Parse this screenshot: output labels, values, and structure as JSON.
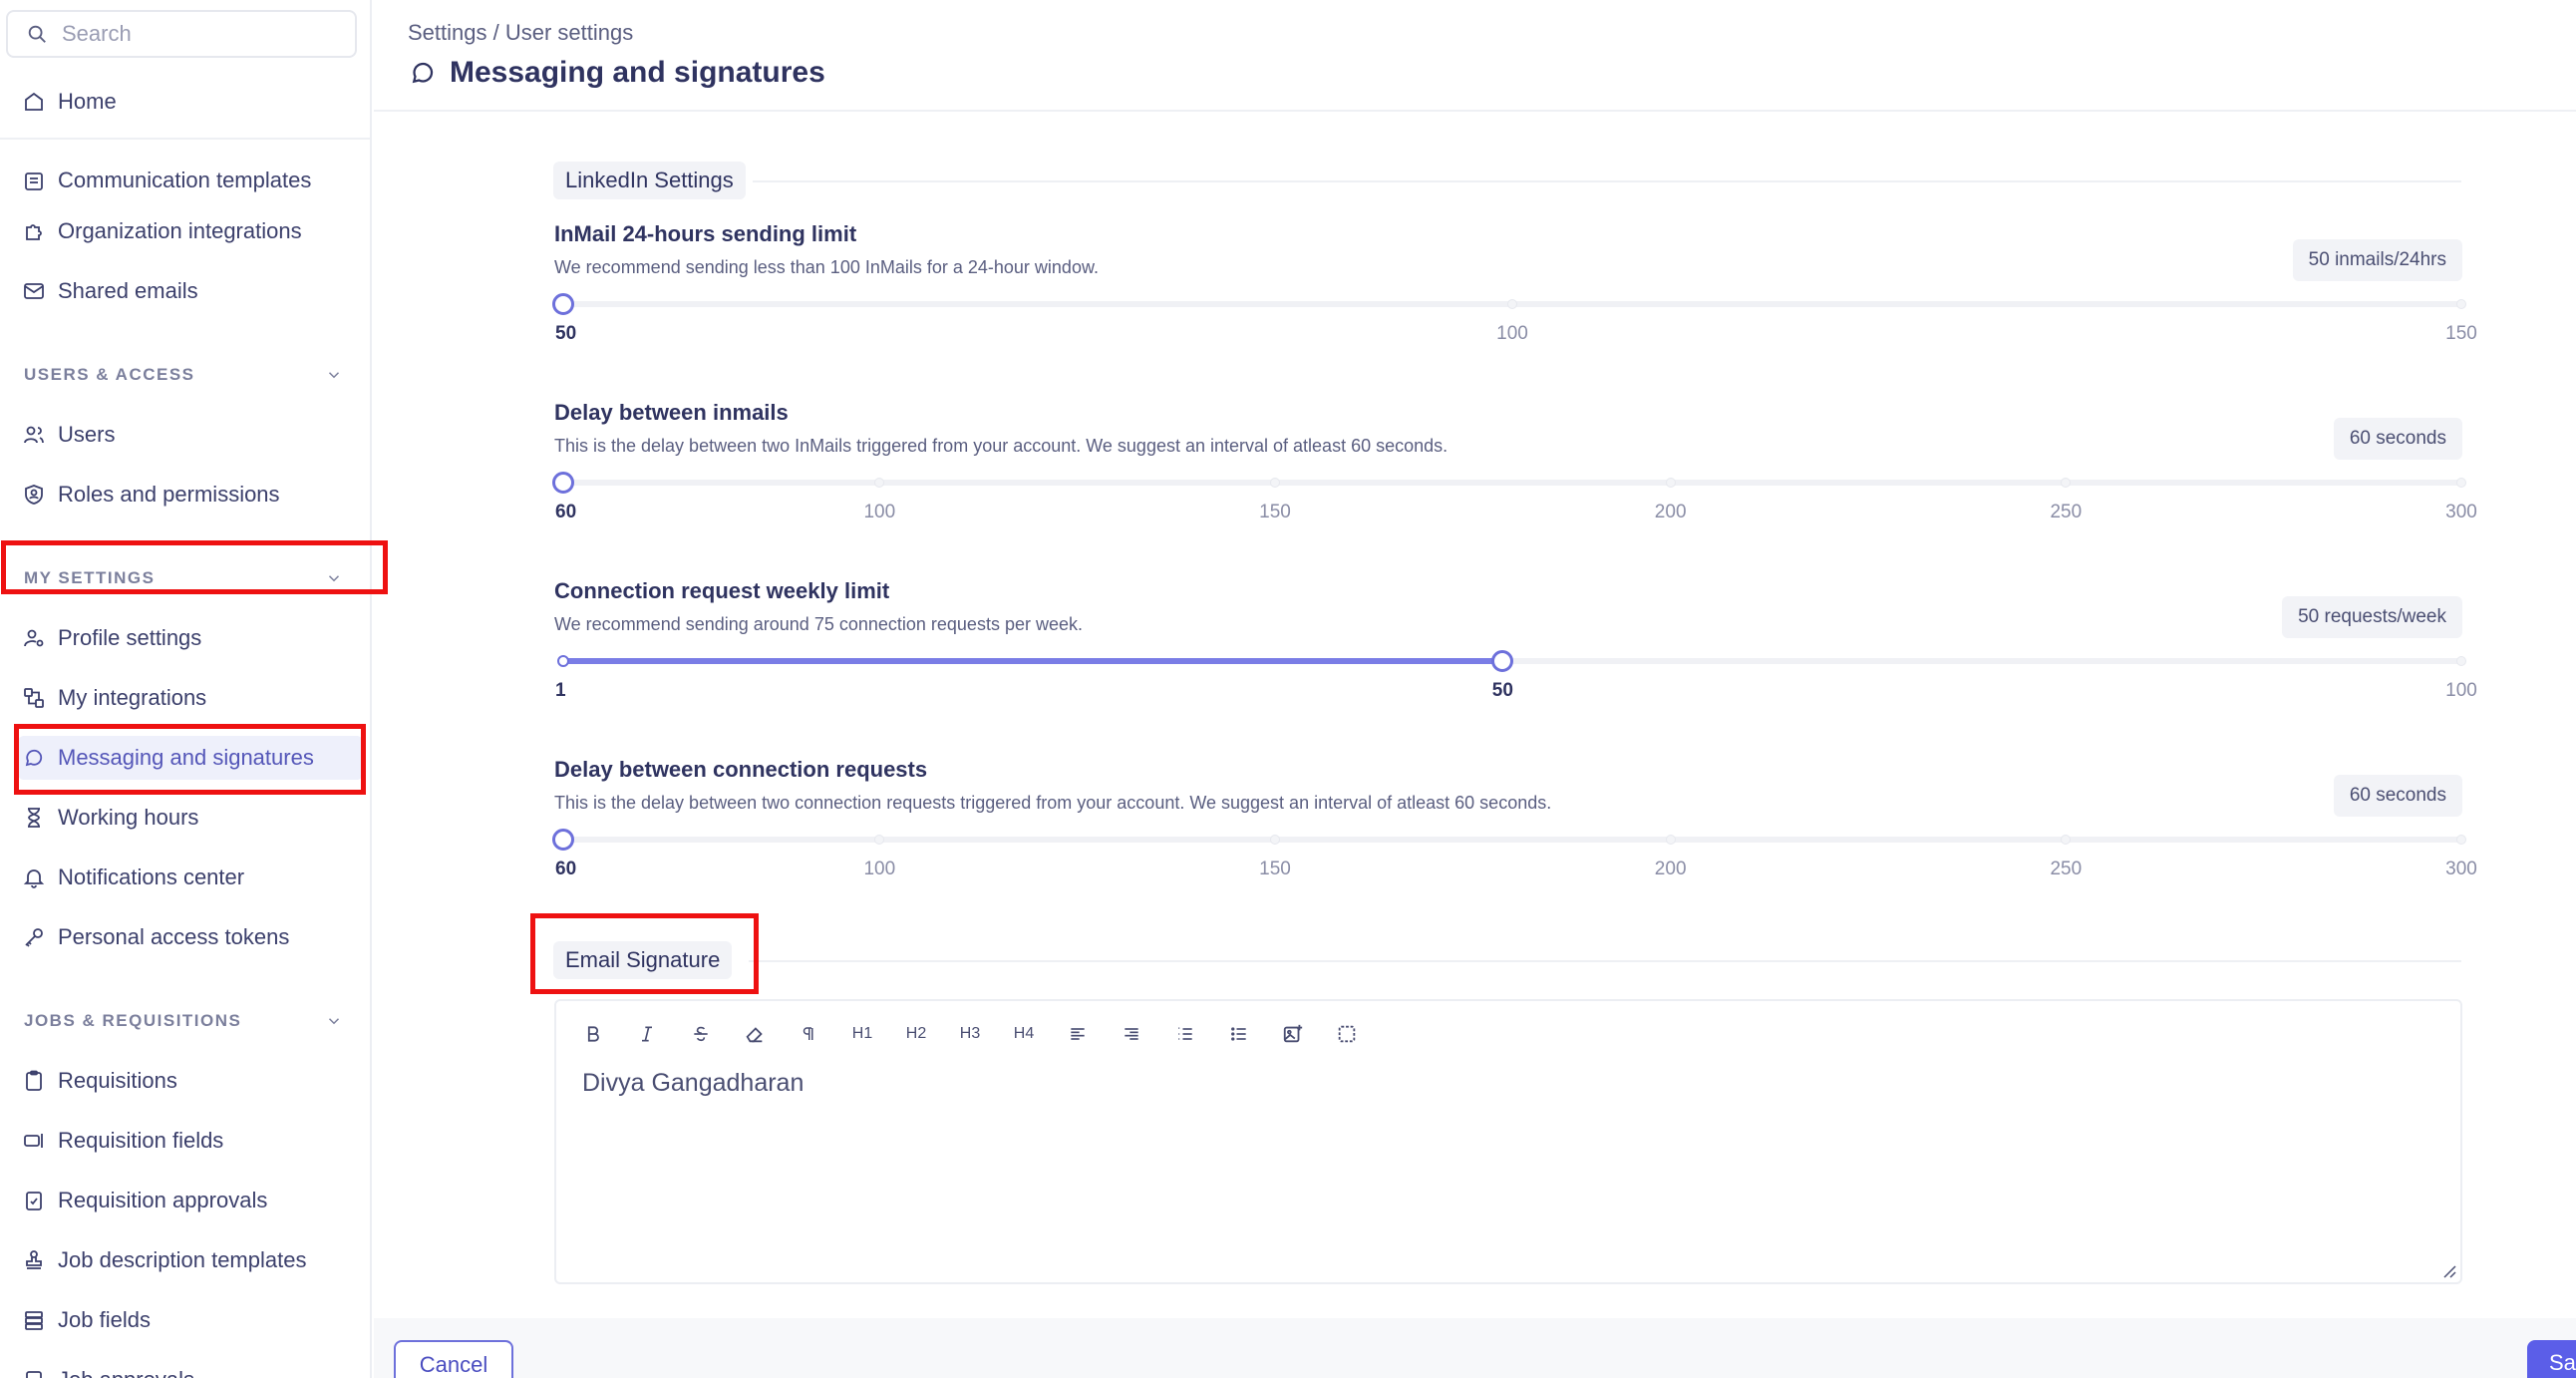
{
  "search": {
    "placeholder": "Search"
  },
  "sidebar": {
    "home": "Home",
    "org_items": [
      "Communication templates",
      "Organization integrations",
      "Shared emails"
    ],
    "users_access": {
      "title": "USERS & ACCESS",
      "items": [
        "Users",
        "Roles and permissions"
      ]
    },
    "my_settings": {
      "title": "MY SETTINGS",
      "items": [
        "Profile settings",
        "My integrations",
        "Messaging and signatures",
        "Working hours",
        "Notifications center",
        "Personal access tokens"
      ]
    },
    "jobs": {
      "title": "JOBS & REQUISITIONS",
      "items": [
        "Requisitions",
        "Requisition fields",
        "Requisition approvals",
        "Job description templates",
        "Job fields",
        "Job approvals"
      ]
    }
  },
  "header": {
    "breadcrumb": "Settings / User settings",
    "title": "Messaging and signatures"
  },
  "linkedin": {
    "section_label": "LinkedIn Settings",
    "settings": [
      {
        "title": "InMail 24-hours sending limit",
        "desc": "We recommend sending less than 100 InMails for a 24-hour window.",
        "badge": "50 inmails/24hrs",
        "min": 50,
        "max": 150,
        "value": 50,
        "labels": [
          "50",
          "100",
          "150"
        ]
      },
      {
        "title": "Delay between inmails",
        "desc": "This is the delay between two InMails triggered from your account. We suggest an interval of atleast 60 seconds.",
        "badge": "60 seconds",
        "min": 60,
        "max": 300,
        "value": 60,
        "labels": [
          "60",
          "100",
          "150",
          "200",
          "250",
          "300"
        ]
      },
      {
        "title": "Connection request weekly limit",
        "desc": "We recommend sending around 75 connection requests per week.",
        "badge": "50 requests/week",
        "min": 1,
        "max": 100,
        "value": 50,
        "labels": [
          "1",
          "50",
          "100"
        ]
      },
      {
        "title": "Delay between connection requests",
        "desc": "This is the delay between two connection requests triggered from your account. We suggest an interval of atleast 60 seconds.",
        "badge": "60 seconds",
        "min": 60,
        "max": 300,
        "value": 60,
        "labels": [
          "60",
          "100",
          "150",
          "200",
          "250",
          "300"
        ]
      }
    ]
  },
  "email_signature": {
    "section_label": "Email Signature",
    "toolbar": {
      "h1": "H1",
      "h2": "H2",
      "h3": "H3",
      "h4": "H4"
    },
    "content": "Divya Gangadharan"
  },
  "footer": {
    "cancel": "Cancel",
    "save": "Save"
  },
  "colors": {
    "accent": "#5b5ee8",
    "highlight": "#ee1111"
  }
}
